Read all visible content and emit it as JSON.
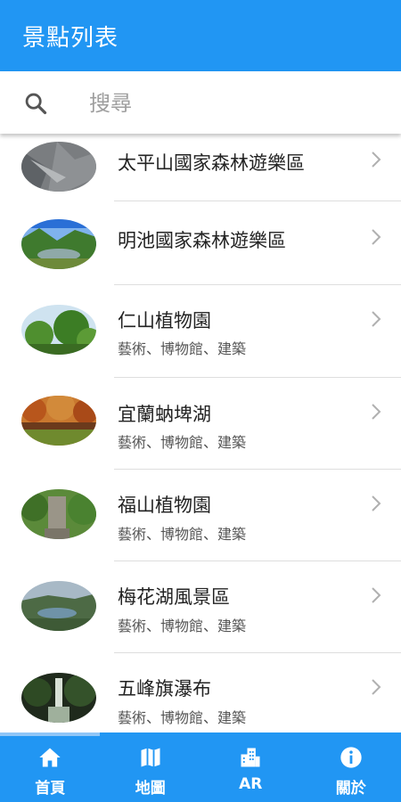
{
  "app_bar": {
    "title": "景點列表"
  },
  "search": {
    "placeholder": "搜尋",
    "icon": "search-icon"
  },
  "spots": [
    {
      "title": "太平山國家森林遊樂區",
      "subtitle": ""
    },
    {
      "title": "明池國家森林遊樂區",
      "subtitle": ""
    },
    {
      "title": "仁山植物園",
      "subtitle": "藝術、博物館、建築"
    },
    {
      "title": "宜蘭蚋埤湖",
      "subtitle": "藝術、博物館、建築"
    },
    {
      "title": "福山植物園",
      "subtitle": "藝術、博物館、建築"
    },
    {
      "title": "梅花湖風景區",
      "subtitle": "藝術、博物館、建築"
    },
    {
      "title": "五峰旗瀑布",
      "subtitle": "藝術、博物館、建築"
    }
  ],
  "bottom_nav": {
    "items": [
      {
        "label": "首頁",
        "icon": "home-icon",
        "selected": true
      },
      {
        "label": "地圖",
        "icon": "map-icon",
        "selected": false
      },
      {
        "label": "AR",
        "icon": "building-icon",
        "selected": false
      },
      {
        "label": "關於",
        "icon": "info-icon",
        "selected": false
      }
    ]
  },
  "colors": {
    "primary": "#2196F3",
    "divider": "#dedede",
    "text": "#222222",
    "subtext": "#555555"
  }
}
